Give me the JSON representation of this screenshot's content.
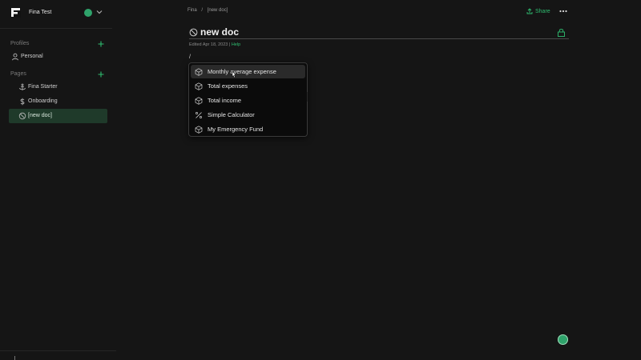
{
  "workspace": {
    "name": "Fina Test"
  },
  "sidebar": {
    "profiles_label": "Profiles",
    "profiles": [
      {
        "label": "Personal",
        "icon": "person-icon"
      }
    ],
    "pages_label": "Pages",
    "pages": [
      {
        "label": "Fina Starter",
        "icon": "anchor-icon"
      },
      {
        "label": "Onboarding",
        "icon": "dollar-icon"
      },
      {
        "label": "[new doc]",
        "icon": "blocked-icon",
        "active": true
      }
    ]
  },
  "topbar": {
    "breadcrumb": [
      "Fina",
      "/",
      "[new doc]"
    ],
    "share_label": "Share"
  },
  "doc": {
    "title": "new doc",
    "edited": "Edited Apr 18, 2023 |",
    "help": "Help",
    "input_text": "/"
  },
  "menu": {
    "items": [
      {
        "label": "Monthly average expense",
        "icon": "cube-icon",
        "highlighted": true
      },
      {
        "label": "Total expenses",
        "icon": "cube-icon"
      },
      {
        "label": "Total income",
        "icon": "cube-icon"
      },
      {
        "label": "Simple Calculator",
        "icon": "percent-icon"
      },
      {
        "label": "My Emergency Fund",
        "icon": "cube-icon"
      }
    ]
  },
  "colors": {
    "accent": "#2fbf71",
    "background": "#151515",
    "active_nav": "#1f3a2a"
  }
}
